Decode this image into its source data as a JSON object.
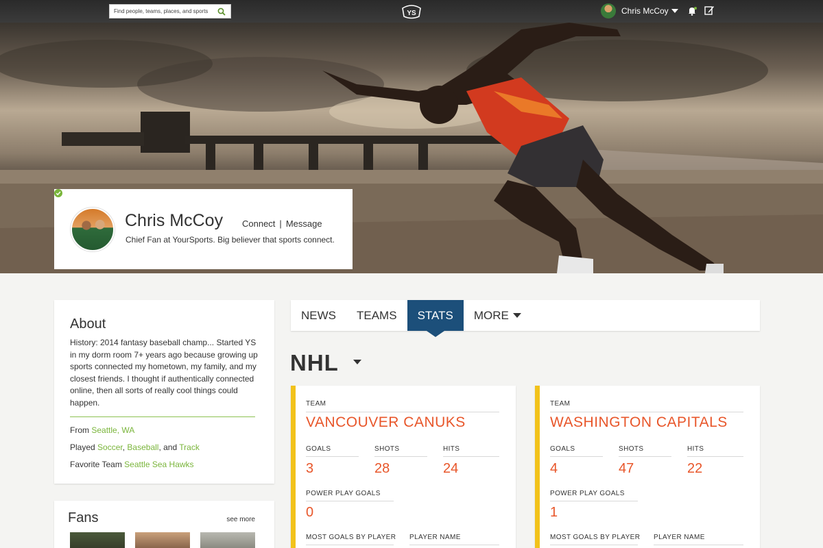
{
  "topbar": {
    "search_placeholder": "Find people, teams, places, and sports",
    "logo": "YS",
    "user_name": "Chris McCoy"
  },
  "profile": {
    "name": "Chris McCoy",
    "connect": "Connect",
    "separator": "|",
    "message": "Message",
    "bio": "Chief Fan at YourSports. Big believer that sports connect."
  },
  "about": {
    "title": "About",
    "bio": "History: 2014 fantasy baseball champ... Started YS in my dorm room 7+ years ago because growing up sports connected my hometown, my family, and my closest friends. I thought if authentically connected online, then all sorts of really cool things could happen.",
    "from_label": "From",
    "from_value": "Seattle, WA",
    "played_label": "Played",
    "played_1": "Soccer",
    "played_sep": ",",
    "played_2": "Baseball",
    "played_and": ", and",
    "played_3": "Track",
    "fav_label": "Favorite Team",
    "fav_value": "Seattle Sea Hawks"
  },
  "fans": {
    "title": "Fans",
    "see_more": "see more"
  },
  "tabs": {
    "news": "NEWS",
    "teams": "TEAMS",
    "stats": "STATS",
    "more": "MORE"
  },
  "league": "NHL",
  "stats": [
    {
      "team_label": "TEAM",
      "team": "VANCOUVER CANUKS",
      "goals_label": "GOALS",
      "goals": "3",
      "shots_label": "SHOTS",
      "shots": "28",
      "hits_label": "HITS",
      "hits": "24",
      "ppg_label": "POWER PLAY GOALS",
      "ppg": "0",
      "mgbp_label": "MOST GOALS BY PLAYER",
      "player_label": "PLAYER NAME"
    },
    {
      "team_label": "TEAM",
      "team": "WASHINGTON CAPITALS",
      "goals_label": "GOALS",
      "goals": "4",
      "shots_label": "SHOTS",
      "shots": "47",
      "hits_label": "HITS",
      "hits": "22",
      "ppg_label": "POWER PLAY GOALS",
      "ppg": "1",
      "mgbp_label": "MOST GOALS BY PLAYER",
      "player_label": "PLAYER NAME"
    }
  ],
  "colors": {
    "accent_green": "#7ab53b",
    "tab_active": "#1c4f7a",
    "stat_orange": "#e8562a",
    "stat_bar": "#f2c21b"
  }
}
